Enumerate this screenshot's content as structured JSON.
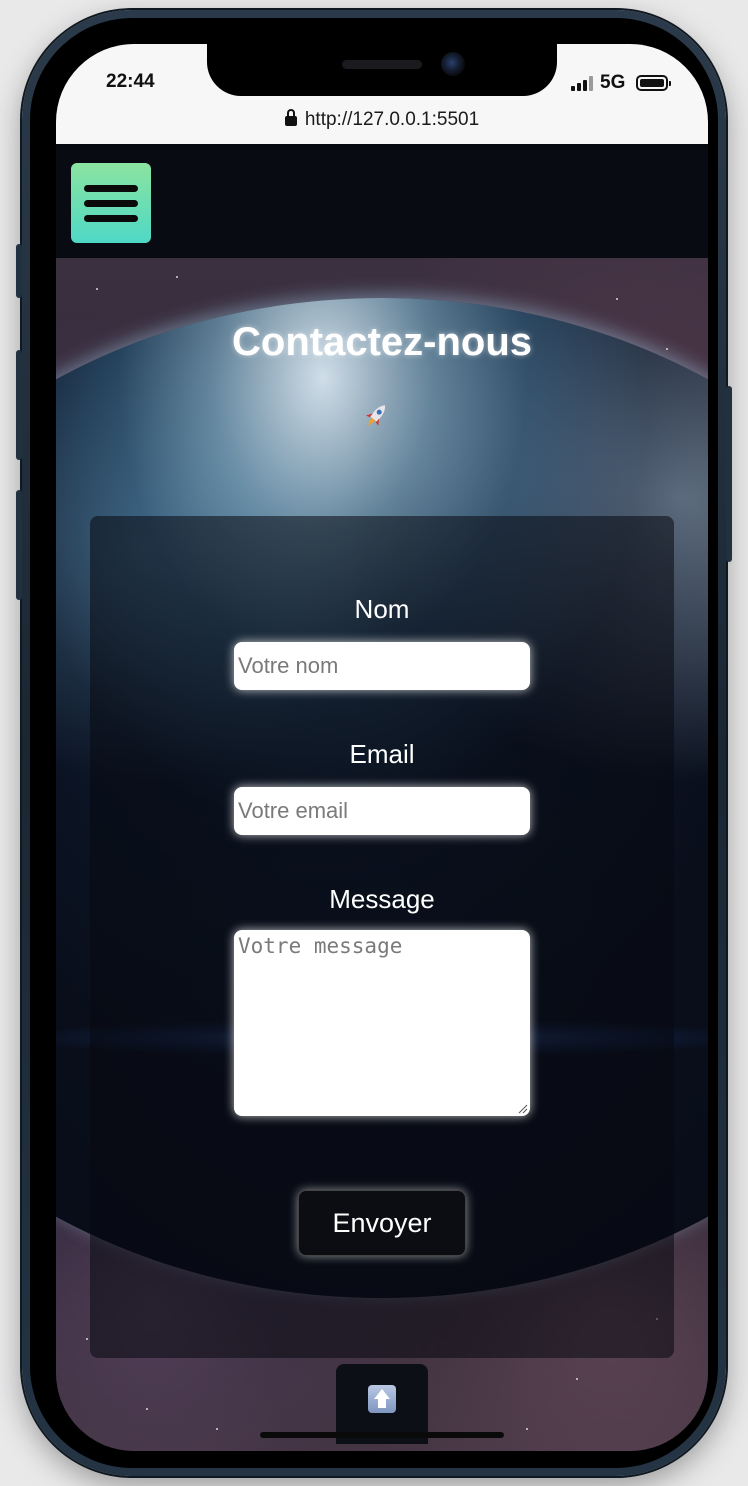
{
  "status_bar": {
    "time": "22:44",
    "network": "5G",
    "icons": [
      "signal-icon",
      "battery-icon"
    ]
  },
  "browser": {
    "url": "http://127.0.0.1:5501",
    "icons": [
      "lock-icon"
    ]
  },
  "navbar": {
    "menu_icon": "hamburger-menu-icon",
    "menu_colors": [
      "#8be4a0",
      "#4fd8c6"
    ]
  },
  "page": {
    "title": "Contactez-nous",
    "title_icon": "rocket-icon"
  },
  "form": {
    "name": {
      "label": "Nom",
      "placeholder": "Votre nom",
      "value": ""
    },
    "email": {
      "label": "Email",
      "placeholder": "Votre email",
      "value": ""
    },
    "message": {
      "label": "Message",
      "placeholder": "Votre message",
      "value": ""
    },
    "submit_label": "Envoyer"
  },
  "scroll_top": {
    "icon": "up-arrow-icon"
  },
  "colors": {
    "accent_gradient_start": "#8be4a0",
    "accent_gradient_end": "#4fd8c6",
    "navbar_bg": "#080c12",
    "text": "#ffffff"
  }
}
